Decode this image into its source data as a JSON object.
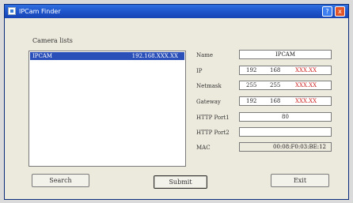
{
  "window": {
    "title": "IPCam Finder"
  },
  "titlebar": {
    "help_label": "?",
    "close_label": "x"
  },
  "camera_list": {
    "label": "Camera lists",
    "items": [
      {
        "name": "IPCAM",
        "ip": "192.168.XXX.XX"
      }
    ]
  },
  "fields": {
    "name": {
      "label": "Name",
      "value": "IPCAM"
    },
    "ip": {
      "label": "IP",
      "seg1": "192",
      "seg2": "168",
      "seg3": "XXX.XX"
    },
    "netmask": {
      "label": "Netmask",
      "seg1": "255",
      "seg2": "255",
      "seg3": "XXX.XX"
    },
    "gateway": {
      "label": "Gateway",
      "seg1": "192",
      "seg2": "168",
      "seg3": "XXX.XX"
    },
    "http_port1": {
      "label": "HTTP Port1",
      "value": "80"
    },
    "http_port2": {
      "label": "HTTP Port2",
      "value": ""
    },
    "mac": {
      "label": "MAC",
      "value": "00:08:F0:03:BE:12"
    }
  },
  "buttons": {
    "search": "Search",
    "submit": "Submit",
    "exit": "Exit"
  },
  "colors": {
    "titlebar": "#1f55cc",
    "selection": "#2a4fb8",
    "ip_highlight": "#cc1f1f"
  }
}
